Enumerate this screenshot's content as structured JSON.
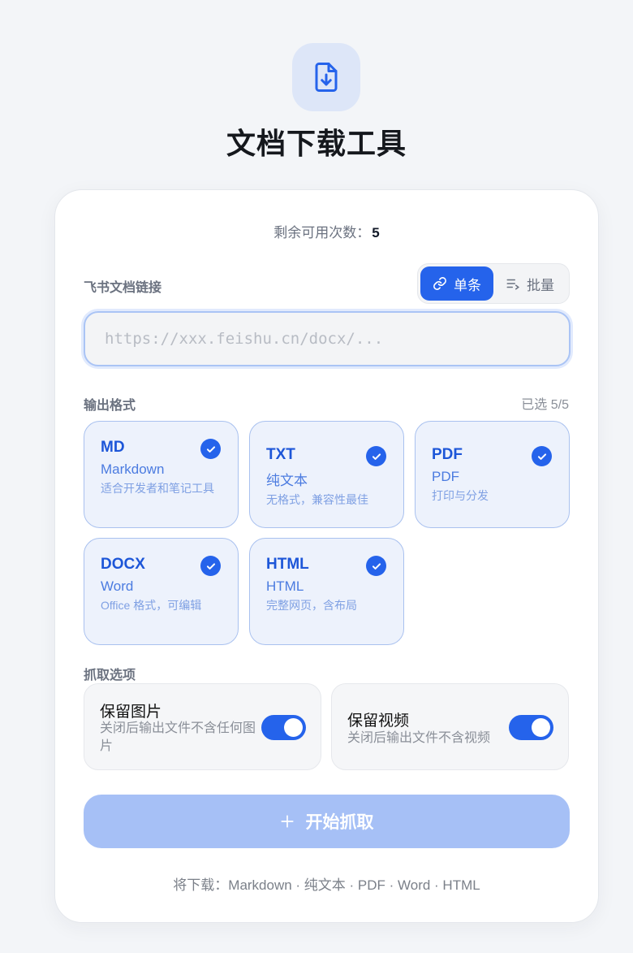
{
  "header": {
    "title": "文档下载工具",
    "icon": "file-download-icon"
  },
  "quota": {
    "label": "剩余可用次数：",
    "value": "5"
  },
  "link_section": {
    "label": "飞书文档链接",
    "modes": [
      {
        "label": "单条",
        "icon": "link-icon",
        "active": true
      },
      {
        "label": "批量",
        "icon": "list-icon",
        "active": false
      }
    ],
    "input": {
      "value": "",
      "placeholder": "https://xxx.feishu.cn/docx/..."
    }
  },
  "format_section": {
    "label": "输出格式",
    "selected_text": "已选 5/5",
    "formats": [
      {
        "code": "MD",
        "name": "Markdown",
        "desc": "适合开发者和笔记工具",
        "checked": true
      },
      {
        "code": "TXT",
        "name": "纯文本",
        "desc": "无格式，兼容性最佳",
        "checked": true
      },
      {
        "code": "PDF",
        "name": "PDF",
        "desc": "打印与分发",
        "checked": true
      },
      {
        "code": "DOCX",
        "name": "Word",
        "desc": "Office 格式，可编辑",
        "checked": true
      },
      {
        "code": "HTML",
        "name": "HTML",
        "desc": "完整网页，含布局",
        "checked": true
      }
    ]
  },
  "options_section": {
    "label": "抓取选项",
    "options": [
      {
        "title": "保留图片",
        "desc": "关闭后输出文件不含任何图片",
        "enabled": true
      },
      {
        "title": "保留视频",
        "desc": "关闭后输出文件不含视频",
        "enabled": true
      }
    ]
  },
  "start_button": {
    "label": "开始抓取",
    "icon": "plus-icon"
  },
  "footer": {
    "text": "将下载：Markdown · 纯文本 · PDF · Word · HTML"
  },
  "colors": {
    "accent": "#2563eb",
    "accent_disabled": "#a6c0f6",
    "card_bg": "#ffffff",
    "page_bg": "#f3f5f8"
  }
}
